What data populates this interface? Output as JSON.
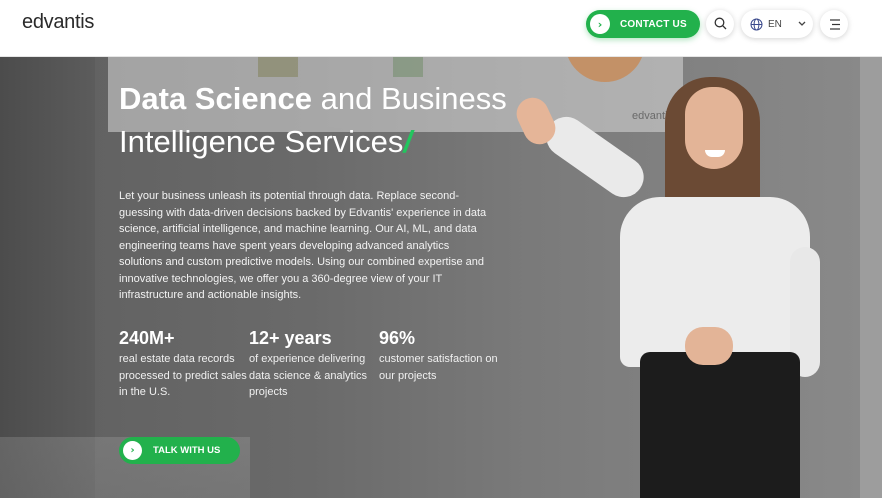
{
  "header": {
    "logo": "edvantis",
    "contact_label": "CONTACT US",
    "language": "EN"
  },
  "hero": {
    "title_bold": "Data Science",
    "title_rest_line1": " and Business",
    "title_line2": "Intelligence Services",
    "title_slash": "/",
    "board_logo": "edvantis",
    "description": "Let your business unleash its potential through data. Replace second-guessing with data-driven decisions backed by Edvantis' experience in data science, artificial intelligence, and machine learning. Our AI, ML, and data engineering teams have spent years developing advanced analytics solutions and custom predictive models. Using our combined expertise and innovative technologies, we offer you a 360-degree view of your IT infrastructure and actionable insights.",
    "stats": [
      {
        "value": "240M+",
        "text": "real estate data records processed to predict sales in the U.S."
      },
      {
        "value": "12+ years",
        "text": "of experience delivering data science & analytics projects"
      },
      {
        "value": "96%",
        "text": "customer satisfaction on our projects"
      }
    ],
    "cta_label": "TALK WITH US"
  },
  "colors": {
    "accent": "#22b14c",
    "hero_overlay": "#6a6a6a"
  },
  "icons": {
    "chevron": "chevron-right-icon",
    "search": "search-icon",
    "globe": "globe-icon",
    "caret": "chevron-down-icon",
    "menu": "menu-icon"
  }
}
